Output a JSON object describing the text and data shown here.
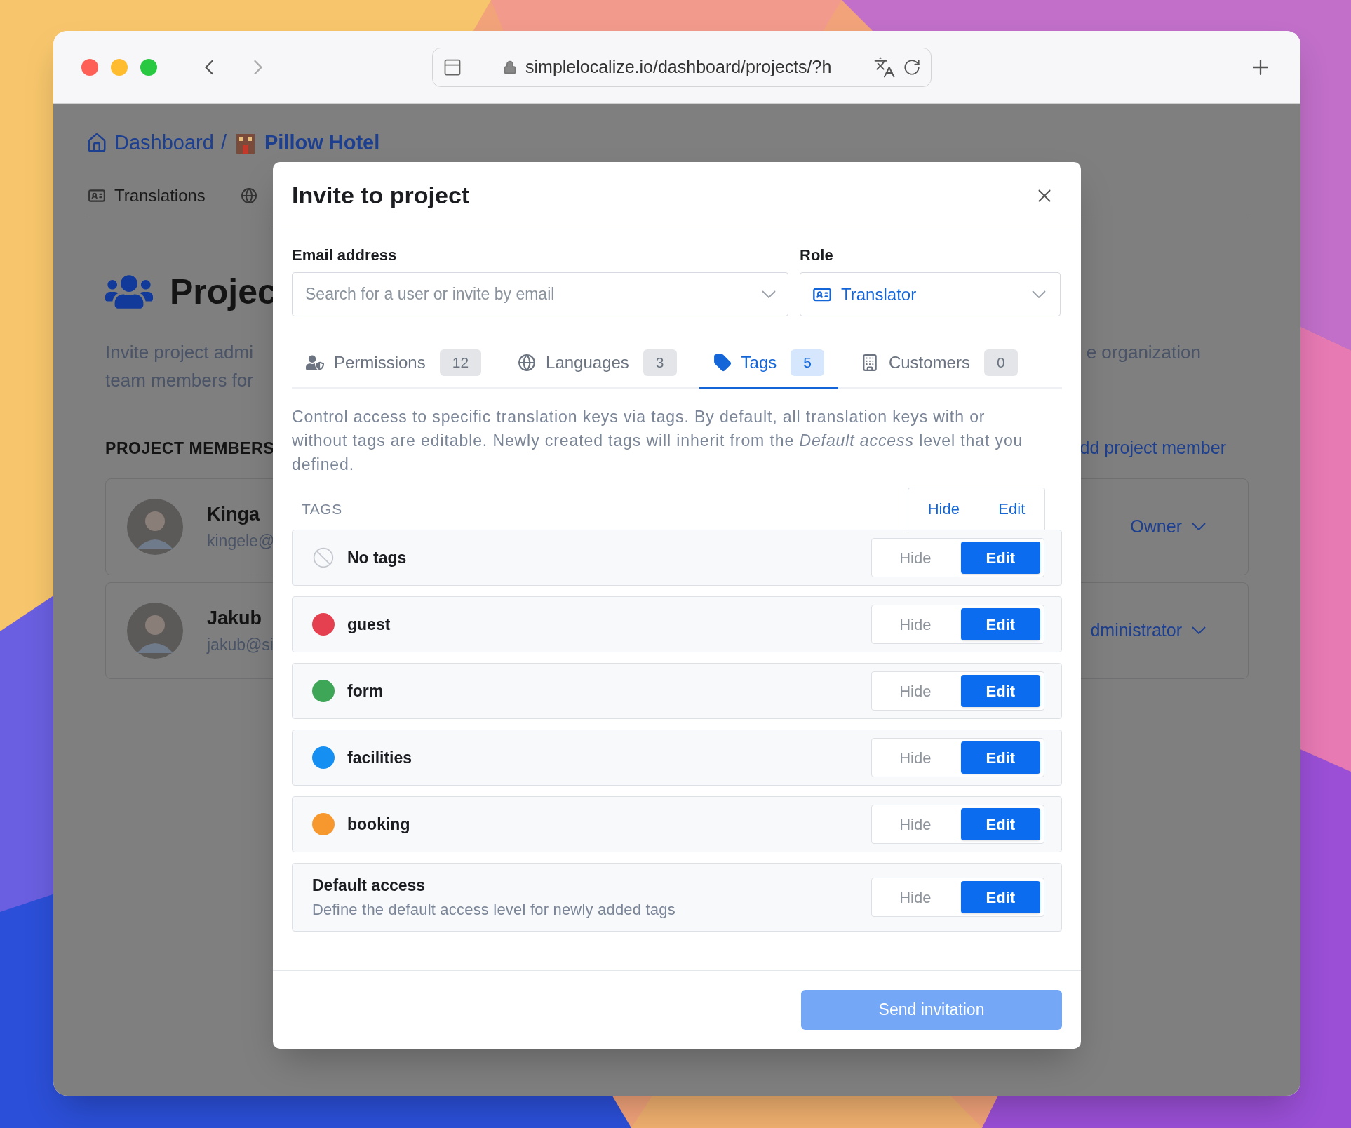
{
  "browser": {
    "url": "simplelocalize.io/dashboard/projects/?h"
  },
  "page": {
    "breadcrumb": [
      "Dashboard",
      "/",
      "Pillow Hotel"
    ],
    "nav_tabs": [
      "Translations"
    ],
    "heading": "Projec",
    "description_left": [
      "Invite project admi",
      "team members for"
    ],
    "description_right": "e organization",
    "members_title": "PROJECT MEMBERS",
    "add_member_link": "dd project member",
    "members": [
      {
        "name": "Kinga",
        "email": "kingele@",
        "role": "Owner"
      },
      {
        "name": "Jakub",
        "email": "jakub@si",
        "role": "dministrator"
      }
    ]
  },
  "modal": {
    "title": "Invite to project",
    "email": {
      "label": "Email address",
      "placeholder": "Search for a user or invite by email"
    },
    "role": {
      "label": "Role",
      "value": "Translator"
    },
    "tabs": [
      {
        "kind": "permissions",
        "label": "Permissions",
        "count": "12",
        "selected": false
      },
      {
        "kind": "languages",
        "label": "Languages",
        "count": "3",
        "selected": false
      },
      {
        "kind": "tags",
        "label": "Tags",
        "count": "5",
        "selected": true
      },
      {
        "kind": "customers",
        "label": "Customers",
        "count": "0",
        "selected": false
      }
    ],
    "description": "Control access to specific translation keys via tags. By default, all translation keys with or without tags are editable. Newly created tags will inherit from the *Default access* level that you defined.",
    "tags_header": {
      "title": "TAGS",
      "options": [
        "Hide",
        "Edit"
      ]
    },
    "rows": [
      {
        "kind": "none",
        "name": "No tags",
        "options": [
          {
            "label": "Hide",
            "selected": false
          },
          {
            "label": "Edit",
            "selected": true
          }
        ]
      },
      {
        "kind": "tag",
        "name": "guest",
        "color": "#e5404f",
        "options": [
          {
            "label": "Hide",
            "selected": false
          },
          {
            "label": "Edit",
            "selected": true
          }
        ]
      },
      {
        "kind": "tag",
        "name": "form",
        "color": "#3ea657",
        "options": [
          {
            "label": "Hide",
            "selected": false
          },
          {
            "label": "Edit",
            "selected": true
          }
        ]
      },
      {
        "kind": "tag",
        "name": "facilities",
        "color": "#168ff2",
        "options": [
          {
            "label": "Hide",
            "selected": false
          },
          {
            "label": "Edit",
            "selected": true
          }
        ]
      },
      {
        "kind": "tag",
        "name": "booking",
        "color": "#f7982f",
        "options": [
          {
            "label": "Hide",
            "selected": false
          },
          {
            "label": "Edit",
            "selected": true
          }
        ]
      },
      {
        "kind": "default",
        "name": "Default access",
        "subtitle": "Define the default access level for newly added tags",
        "options": [
          {
            "label": "Hide",
            "selected": false
          },
          {
            "label": "Edit",
            "selected": true
          }
        ]
      }
    ],
    "send_button": {
      "label": "Send invitation",
      "disabled": true
    }
  }
}
